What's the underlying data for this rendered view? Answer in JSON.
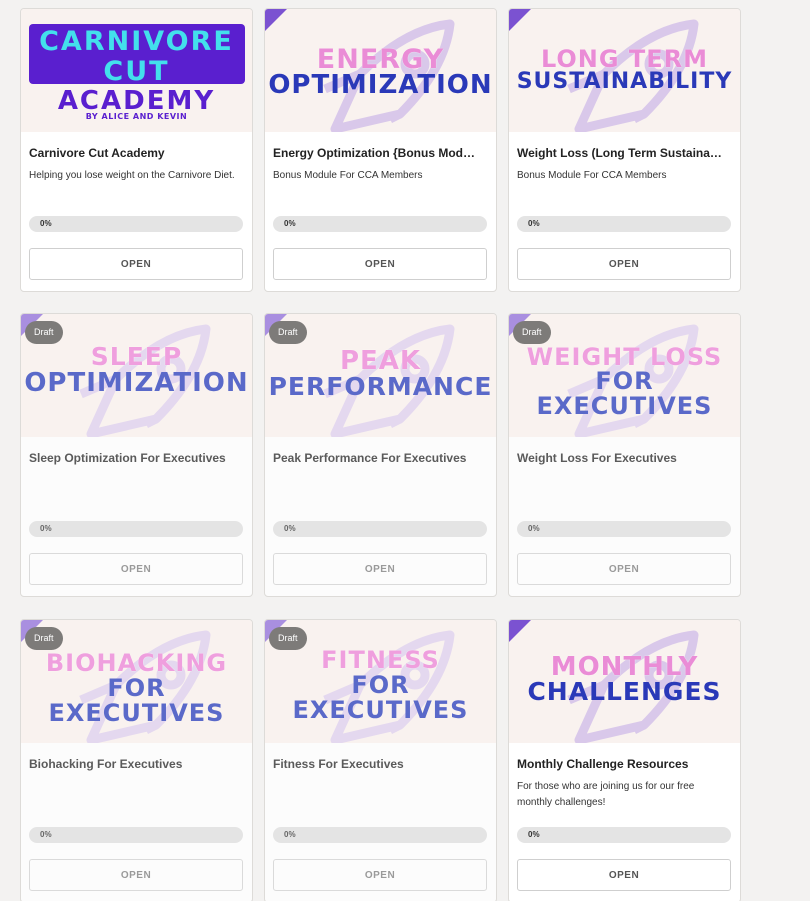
{
  "courses": [
    {
      "title": "Carnivore Cut Academy",
      "description": "Helping you lose weight on the Carnivore Diet.",
      "progress_label": "0%",
      "progress": 0,
      "button": "OPEN",
      "thumb": {
        "line1": "CARNIVORE",
        "line2": "CUT",
        "line3": "ACADEMY",
        "line4": "BY ALICE AND KEVIN"
      }
    },
    {
      "title": "Energy Optimization {Bonus Mod…",
      "description": "Bonus Module For CCA Members",
      "progress_label": "0%",
      "progress": 0,
      "button": "OPEN",
      "thumb": {
        "line1": "ENERGY",
        "line2": "OPTIMIZATION"
      }
    },
    {
      "title": "Weight Loss (Long Term Sustaina…",
      "description": "Bonus Module For CCA Members",
      "progress_label": "0%",
      "progress": 0,
      "button": "OPEN",
      "thumb": {
        "line1": "LONG TERM",
        "line2": "SUSTAINABILITY"
      }
    },
    {
      "badge": "Draft",
      "title": "Sleep Optimization For Executives",
      "description": "",
      "progress_label": "0%",
      "progress": 0,
      "button": "OPEN",
      "thumb": {
        "line1": "SLEEP",
        "line2": "OPTIMIZATION"
      }
    },
    {
      "badge": "Draft",
      "title": "Peak Performance For Executives",
      "description": "",
      "progress_label": "0%",
      "progress": 0,
      "button": "OPEN",
      "thumb": {
        "line1": "PEAK",
        "line2": "PERFORMANCE"
      }
    },
    {
      "badge": "Draft",
      "title": "Weight Loss For Executives",
      "description": "",
      "progress_label": "0%",
      "progress": 0,
      "button": "OPEN",
      "thumb": {
        "line1": "WEIGHT LOSS",
        "line2": "FOR",
        "line3": "EXECUTIVES"
      }
    },
    {
      "badge": "Draft",
      "title": "Biohacking For Executives",
      "description": "",
      "progress_label": "0%",
      "progress": 0,
      "button": "OPEN",
      "thumb": {
        "line1": "BIOHACKING",
        "line2": "FOR",
        "line3": "EXECUTIVES"
      }
    },
    {
      "badge": "Draft",
      "title": "Fitness For Executives",
      "description": "",
      "progress_label": "0%",
      "progress": 0,
      "button": "OPEN",
      "thumb": {
        "line1": "FITNESS",
        "line2": "FOR",
        "line3": "EXECUTIVES"
      }
    },
    {
      "title": "Monthly Challenge Resources",
      "description": "For those who are joining us for our free monthly challenges!",
      "progress_label": "0%",
      "progress": 0,
      "button": "OPEN",
      "thumb": {
        "line1": "MONTHLY",
        "line2": "CHALLENGES"
      }
    }
  ],
  "colors": {
    "page_bg": "#f3f2f1",
    "thumb_bg": "#f9f2ef",
    "accent_purple": "#7b52d1",
    "title_pink": "#ea8cd6",
    "title_blue": "#2a39b8",
    "logo_box": "#5a1fcf",
    "logo_cyan": "#43e0ec",
    "draft_badge": "#7d7b79"
  },
  "icons": [
    "rocket-watermark-icon",
    "corner-ribbon-icon"
  ]
}
